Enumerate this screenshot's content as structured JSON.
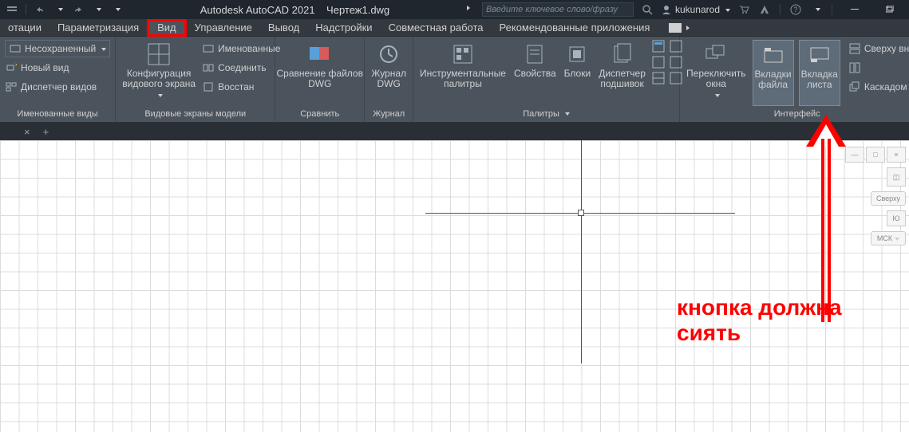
{
  "titlebar": {
    "app": "Autodesk AutoCAD 2021",
    "file": "Чертеж1.dwg",
    "search_placeholder": "Введите ключевое слово/фразу",
    "username": "kukunarod"
  },
  "menu": {
    "items": [
      "отации",
      "Параметризация",
      "Вид",
      "Управление",
      "Вывод",
      "Надстройки",
      "Совместная работа",
      "Рекомендованные приложения"
    ],
    "active_index": 2
  },
  "ribbon": {
    "panels": [
      {
        "title": "Именованные виды",
        "rows": [
          "Несохраненный",
          "Новый вид",
          "Диспетчер видов"
        ]
      },
      {
        "title": "Видовые экраны модели",
        "big": "Конфигурация\nвидового экрана",
        "rows": [
          "Именованные",
          "Соединить",
          "Восстан"
        ]
      },
      {
        "title": "Сравнить",
        "big": "Сравнение файлов\nDWG"
      },
      {
        "title": "Журнал",
        "big": "Журнал\nDWG"
      },
      {
        "title": "Палитры",
        "items": [
          "Инструментальные\nпалитры",
          "Свойства",
          "Блоки",
          "Диспетчер\nподшивок"
        ]
      },
      {
        "title": "Интерфейс",
        "items": [
          "Переключить\nокна",
          "Вкладки\nфайла",
          "Вкладка\nлиста"
        ],
        "side_rows": [
          "Сверху вн",
          "Каскадом"
        ]
      }
    ]
  },
  "doctabs": {
    "close": "×",
    "add": "+"
  },
  "navcol": {
    "top_label": "Сверху",
    "wcs": "МСК"
  },
  "annotation": {
    "line1": "кнопка должна",
    "line2": "сиять"
  }
}
